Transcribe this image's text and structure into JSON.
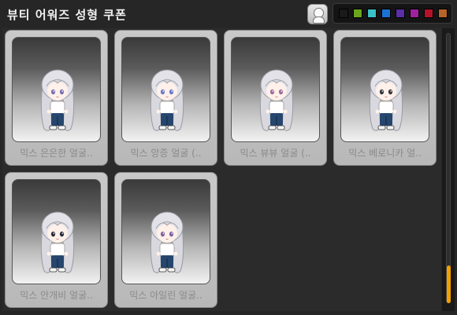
{
  "window": {
    "title": "뷰티 어워즈 성형 쿠폰"
  },
  "toolbar": {
    "avatar_button_icon": "character-preview-icon",
    "palette_colors": [
      "#1a1a1a",
      "#6aa51c",
      "#39c1c6",
      "#1b72d6",
      "#5b2fa6",
      "#a0209e",
      "#b5122a",
      "#b5642a"
    ]
  },
  "coupons": [
    {
      "label": "믹스 은은한 얼굴..",
      "eye": "#7a6fb0"
    },
    {
      "label": "믹스 앙증 얼굴 (..",
      "eye": "#6a78c8"
    },
    {
      "label": "믹스 뷰뷰 얼굴 (..",
      "eye": "#a06a9a"
    },
    {
      "label": "믹스 베로니카 얼..",
      "eye": "#33333a"
    },
    {
      "label": "믹스 안개비 얼굴..",
      "eye": "#2a2a38"
    },
    {
      "label": "믹스 아일린 얼굴..",
      "eye": "#8060a0"
    }
  ],
  "scrollbar": {
    "position": 1.0
  }
}
